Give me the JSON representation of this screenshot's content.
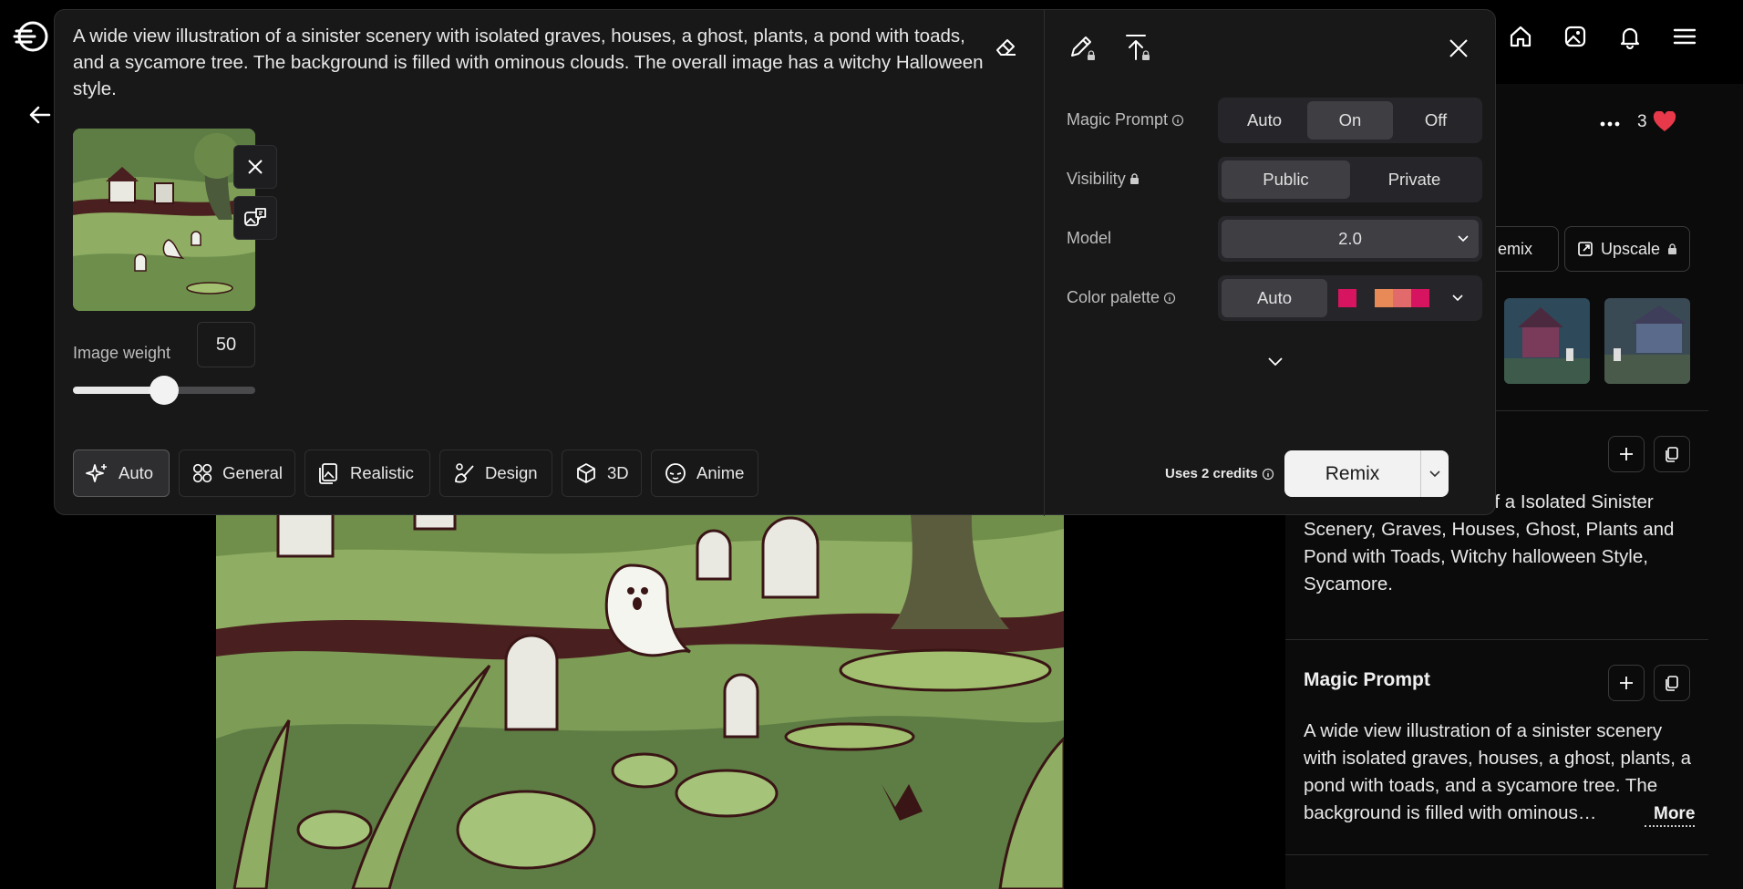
{
  "overlay": {
    "prompt_text": "A wide view illustration of a sinister scenery with isolated graves, houses, a ghost, plants, a pond with toads, and a sycamore tree. The background is filled with ominous clouds. The overall image has a witchy Halloween style.",
    "image_weight_label": "Image weight",
    "image_weight_value": "50",
    "image_weight_level": 0.5,
    "styles": [
      {
        "label": "Auto",
        "icon": "sparkle-icon",
        "active": true
      },
      {
        "label": "General",
        "icon": "grid-icon",
        "active": false
      },
      {
        "label": "Realistic",
        "icon": "photo-stack-icon",
        "active": false
      },
      {
        "label": "Design",
        "icon": "design-icon",
        "active": false
      },
      {
        "label": "3D",
        "icon": "cube-icon",
        "active": false
      },
      {
        "label": "Anime",
        "icon": "anime-face-icon",
        "active": false
      }
    ],
    "settings": {
      "magic_prompt": {
        "label": "Magic Prompt",
        "options": [
          "Auto",
          "On",
          "Off"
        ],
        "selected": "On"
      },
      "visibility": {
        "label": "Visibility",
        "options": [
          "Public",
          "Private"
        ],
        "selected": "Public"
      },
      "model": {
        "label": "Model",
        "value": "2.0"
      },
      "color_palette": {
        "label": "Color palette",
        "value": "Auto",
        "swatches": [
          "#d7145f",
          "#e88a57",
          "#e26a6a",
          "#d7145f"
        ]
      }
    },
    "credits_text": "Uses 2 credits",
    "remix_label": "Remix"
  },
  "sidebar": {
    "likes": "3",
    "remix_partial": "emix",
    "upscale_label": "Upscale",
    "prompt_partial_text": "of a Isolated Sinister Scenery, Graves, Houses, Ghost, Plants and Pond with Toads, Witchy halloween Style, Sycamore.",
    "magic_prompt_title": "Magic Prompt",
    "magic_prompt_text": "A wide view illustration of a sinister scenery with isolated graves, houses, a ghost, plants, a pond with toads, and a sycamore tree. The background is filled with ominous…",
    "more_label": "More"
  },
  "colors": {
    "accent_heart": "#e8394a",
    "art_green": "#8fae63",
    "art_dark": "#4a1f1f"
  }
}
